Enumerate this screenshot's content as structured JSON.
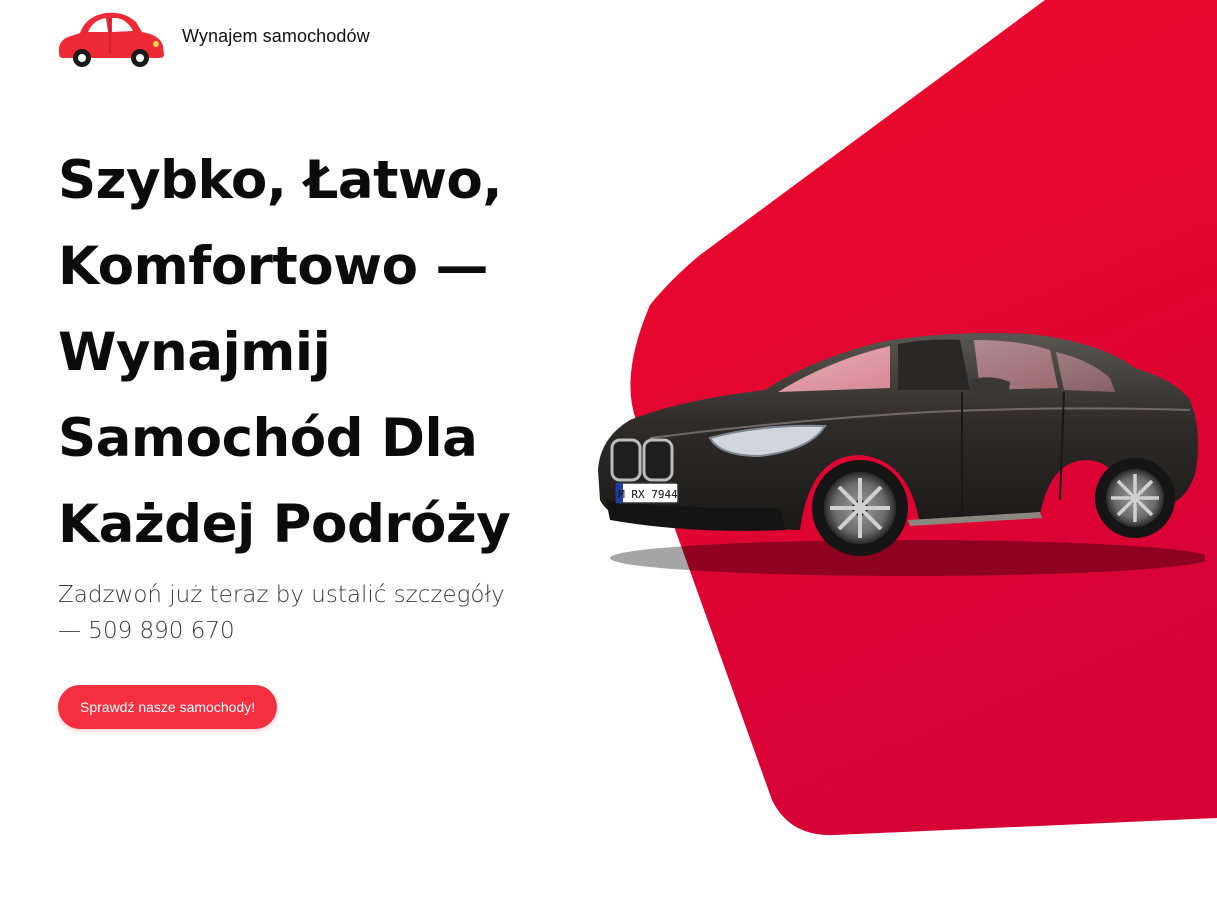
{
  "header": {
    "logo_icon": "red-car-icon",
    "brand_name": "Wynajem samochodów"
  },
  "hero": {
    "headline_lines": [
      "Szybko, Łatwo,",
      "Komfortowo —",
      "Wynajmij",
      "Samochód Dla",
      "Każdej Podróży"
    ],
    "subtext_line1": "Zadzwoń już teraz by ustalić szczegóły",
    "subtext_line2": "— 509 890 670",
    "cta_label": "Sprawdź nasze samochody!",
    "car_plate": "M RX 7944"
  },
  "colors": {
    "accent": "#f42f3f",
    "hero_red": "#ee0a2c",
    "hero_red_dark": "#d10033",
    "text": "#0b0b0b",
    "subtext": "#3a3a3a"
  }
}
